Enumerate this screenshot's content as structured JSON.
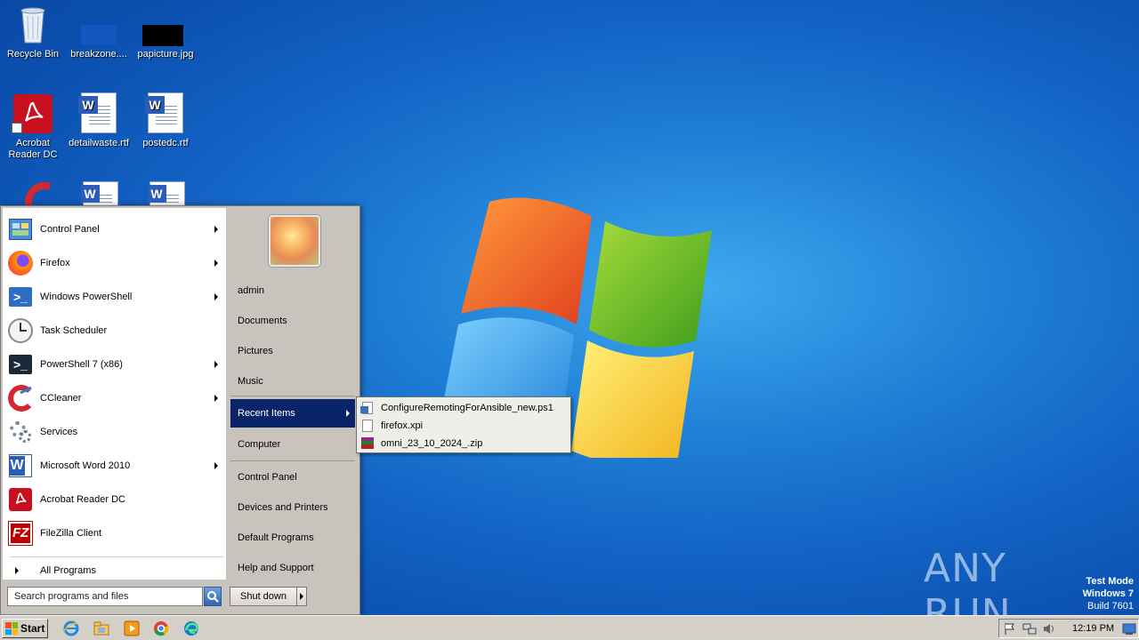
{
  "desktop": {
    "icons": [
      {
        "label": "Recycle Bin"
      },
      {
        "label": "breakzone...."
      },
      {
        "label": "papicture.jpg"
      },
      {
        "label": "Acrobat Reader DC"
      },
      {
        "label": "detailwaste.rtf"
      },
      {
        "label": "postedc.rtf"
      }
    ],
    "watermark": "ANY RUN",
    "test_mode": {
      "line1": "Test Mode",
      "line2": "Windows 7",
      "line3": "Build 7601"
    }
  },
  "start_menu": {
    "programs": [
      {
        "label": "Control Panel",
        "icon": "control-panel-icon",
        "submenu": true
      },
      {
        "label": "Firefox",
        "icon": "firefox-icon",
        "submenu": true
      },
      {
        "label": "Windows PowerShell",
        "icon": "powershell-icon",
        "submenu": true
      },
      {
        "label": "Task Scheduler",
        "icon": "task-scheduler-icon",
        "submenu": false
      },
      {
        "label": "PowerShell 7 (x86)",
        "icon": "powershell7-icon",
        "submenu": true
      },
      {
        "label": "CCleaner",
        "icon": "ccleaner-icon",
        "submenu": true
      },
      {
        "label": "Services",
        "icon": "services-icon",
        "submenu": false
      },
      {
        "label": "Microsoft Word 2010",
        "icon": "word-icon",
        "submenu": true
      },
      {
        "label": "Acrobat Reader DC",
        "icon": "acrobat-icon",
        "submenu": false
      },
      {
        "label": "FileZilla Client",
        "icon": "filezilla-icon",
        "submenu": false
      }
    ],
    "all_programs": "All Programs",
    "search_placeholder": "Search programs and files",
    "places": [
      {
        "label": "admin"
      },
      {
        "label": "Documents"
      },
      {
        "label": "Pictures"
      },
      {
        "label": "Music"
      },
      {
        "label": "Recent Items"
      },
      {
        "label": "Computer"
      },
      {
        "label": "Control Panel"
      },
      {
        "label": "Devices and Printers"
      },
      {
        "label": "Default Programs"
      },
      {
        "label": "Help and Support"
      }
    ],
    "shutdown_label": "Shut down"
  },
  "recent_items": [
    {
      "label": "ConfigureRemotingForAnsible_new.ps1",
      "icon": "script-file-icon"
    },
    {
      "label": "firefox.xpi",
      "icon": "blank-file-icon"
    },
    {
      "label": "omni_23_10_2024_.zip",
      "icon": "archive-icon"
    }
  ],
  "taskbar": {
    "start_label": "Start",
    "clock": "12:19 PM"
  }
}
